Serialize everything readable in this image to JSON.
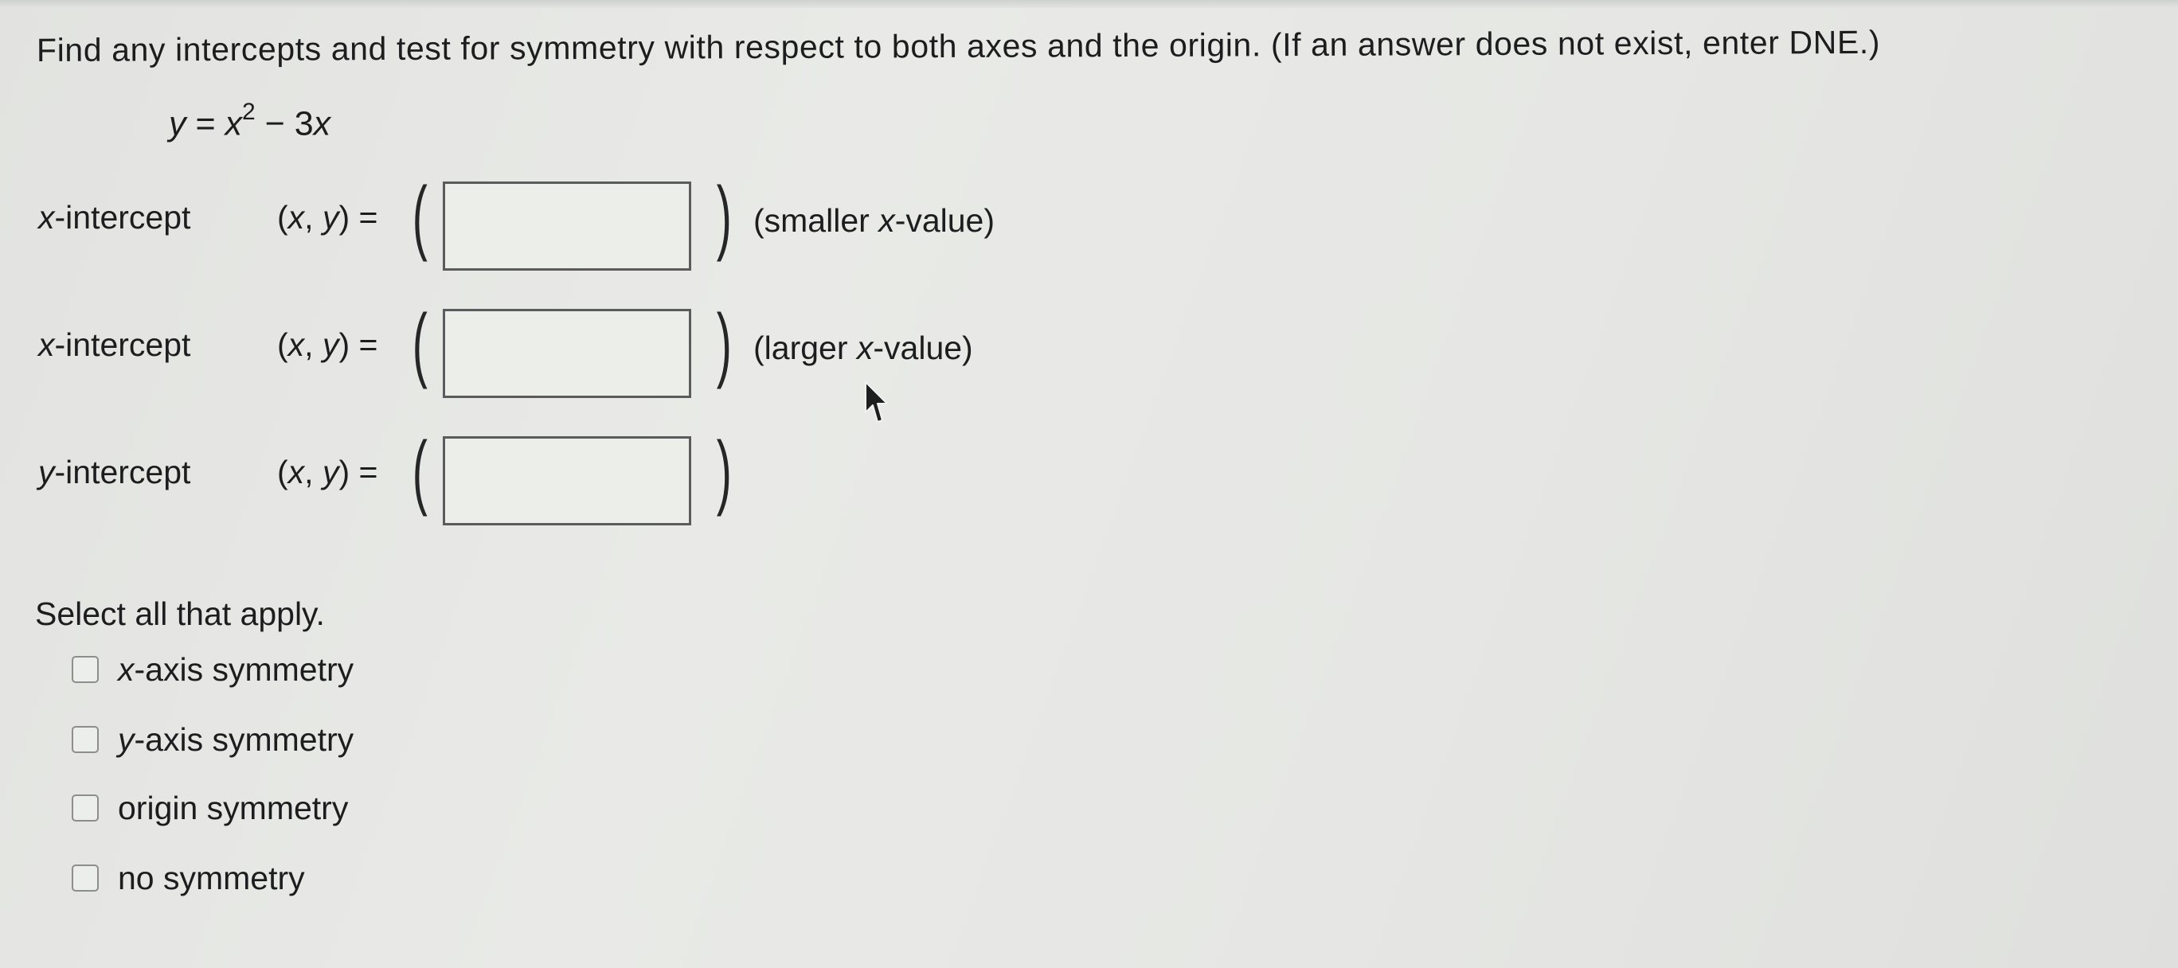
{
  "question": {
    "text": "Find any intercepts and test for symmetry with respect to both axes and the origin. (If an answer does not exist, enter DNE.)"
  },
  "equation": {
    "lhs_var": "y",
    "equals": " = ",
    "base_var": "x",
    "exponent": "2",
    "rest_pre": " − 3",
    "rest_var": "x"
  },
  "rows": [
    {
      "label_var": "x",
      "label_text": "-intercept",
      "pair_open": "(",
      "pair_x": "x",
      "pair_sep": ", ",
      "pair_y": "y",
      "pair_close": ") =",
      "value": "",
      "note_pre": "(smaller ",
      "note_var": "x",
      "note_post": "-value)"
    },
    {
      "label_var": "x",
      "label_text": "-intercept",
      "pair_open": "(",
      "pair_x": "x",
      "pair_sep": ", ",
      "pair_y": "y",
      "pair_close": ") =",
      "value": "",
      "note_pre": "(larger ",
      "note_var": "x",
      "note_post": "-value)"
    },
    {
      "label_var": "y",
      "label_text": "-intercept",
      "pair_open": "(",
      "pair_x": "x",
      "pair_sep": ", ",
      "pair_y": "y",
      "pair_close": ") =",
      "value": ""
    }
  ],
  "paren_open": "(",
  "paren_close": ")",
  "select_all": "Select all that apply.",
  "options": [
    {
      "var": "x",
      "text": "-axis symmetry",
      "checked": false
    },
    {
      "var": "y",
      "text": "-axis symmetry",
      "checked": false
    },
    {
      "var": "",
      "text": "origin symmetry",
      "checked": false
    },
    {
      "var": "",
      "text": "no symmetry",
      "checked": false
    }
  ],
  "icons": {
    "cursor": "mouse-pointer-icon"
  },
  "colors": {
    "text": "#1d1d1f",
    "box_border": "#5a5b5d",
    "background": "#e6e7e4"
  }
}
